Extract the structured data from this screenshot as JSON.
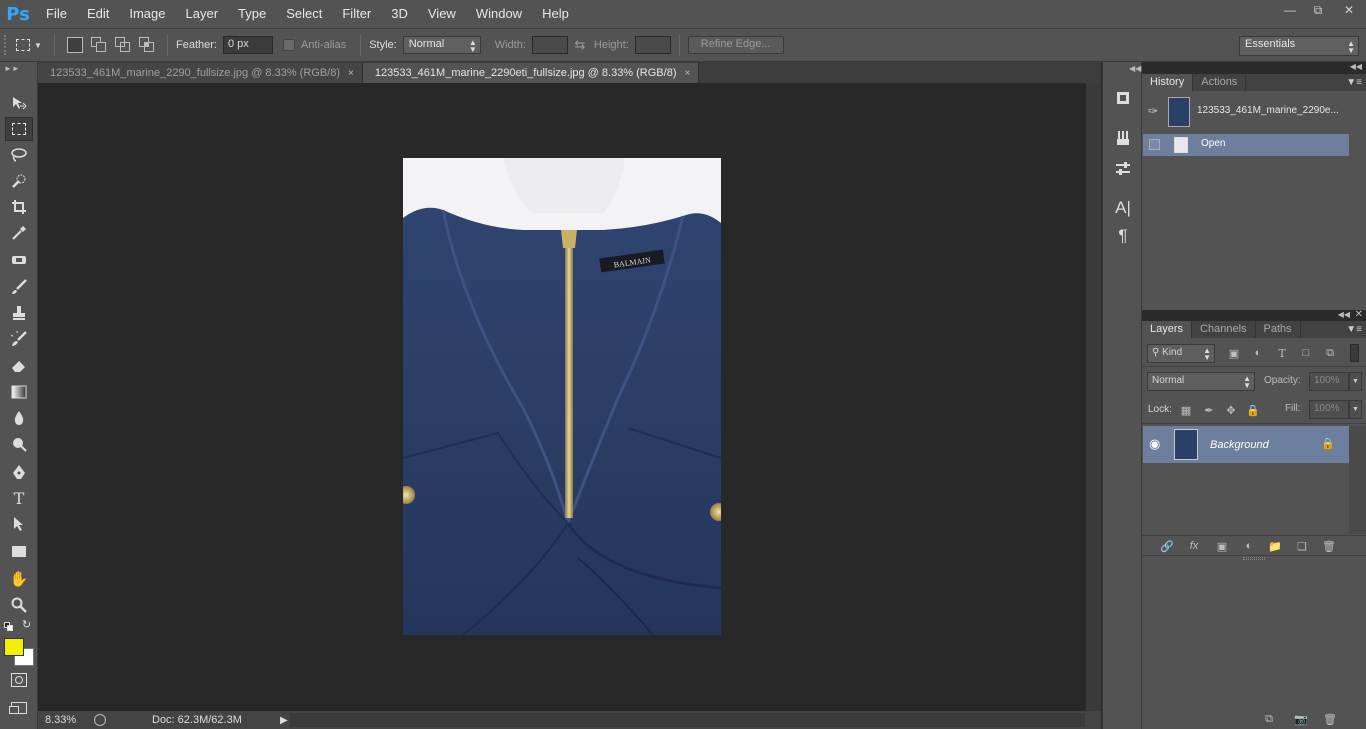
{
  "app": {
    "logo": "Ps"
  },
  "menu": [
    "File",
    "Edit",
    "Image",
    "Layer",
    "Type",
    "Select",
    "Filter",
    "3D",
    "View",
    "Window",
    "Help"
  ],
  "window_controls": [
    "minimize-icon",
    "restore-icon",
    "close-icon"
  ],
  "options": {
    "feather_label": "Feather:",
    "feather_value": "0 px",
    "antialias_label": "Anti-alias",
    "style_label": "Style:",
    "style_value": "Normal",
    "width_label": "Width:",
    "height_label": "Height:",
    "refine_edge": "Refine Edge...",
    "workspace": "Essentials"
  },
  "tabs": [
    {
      "label": "123533_461M_marine_2290_fullsize.jpg @ 8.33% (RGB/8)",
      "active": false,
      "close": "×"
    },
    {
      "label": "123533_461M_marine_2290eti_fullsize.jpg @ 8.33% (RGB/8)",
      "active": true,
      "close": "×"
    }
  ],
  "tools": [
    "move-icon",
    "marquee-icon",
    "lasso-icon",
    "quick-select-icon",
    "crop-icon",
    "eyedropper-icon",
    "spot-heal-icon",
    "brush-icon",
    "stamp-icon",
    "history-brush-icon",
    "eraser-icon",
    "gradient-icon",
    "blur-icon",
    "dodge-icon",
    "pen-icon",
    "type-icon",
    "path-select-icon",
    "rectangle-icon",
    "hand-icon",
    "zoom-icon"
  ],
  "colors": {
    "foreground": "#f0f000",
    "background": "#ffffff",
    "accent": "#31a8ff",
    "selected_row": "#6d7f9c"
  },
  "status": {
    "zoom": "8.33%",
    "doc": "Doc: 62.3M/62.3M"
  },
  "history": {
    "tabs": [
      "History",
      "Actions"
    ],
    "snapshot_label": "123533_461M_marine_2290e...",
    "items": [
      {
        "label": "Open",
        "selected": true
      }
    ]
  },
  "layers": {
    "tabs": [
      "Layers",
      "Channels",
      "Paths"
    ],
    "filter_kind": "Kind",
    "blend_mode": "Normal",
    "opacity_label": "Opacity:",
    "opacity_value": "100%",
    "lock_label": "Lock:",
    "fill_label": "Fill:",
    "fill_value": "100%",
    "items": [
      {
        "name": "Background",
        "visible": true,
        "locked": true
      }
    ]
  },
  "image": {
    "label_text": "BALMAIN"
  }
}
